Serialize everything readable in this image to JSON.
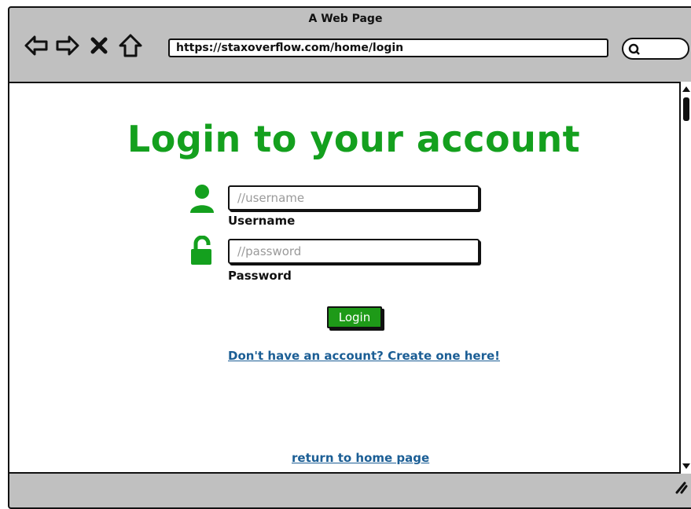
{
  "window": {
    "title": "A Web Page"
  },
  "toolbar": {
    "url": "https://staxoverflow.com/home/login",
    "back_icon": "arrow-left-icon",
    "forward_icon": "arrow-right-icon",
    "stop_icon": "close-x-icon",
    "home_icon": "home-icon",
    "search_icon": "search-icon"
  },
  "login": {
    "title": "Login to your account",
    "username_placeholder": "//username",
    "username_label": "Username",
    "password_placeholder": "//password",
    "password_label": "Password",
    "button_label": "Login",
    "create_account_link": "Don't have an account? Create one here!",
    "return_link": "return to home page"
  },
  "colors": {
    "accent_green": "#14a01e",
    "button_green": "#1e9a18",
    "link_blue": "#1b5e95",
    "chrome_gray": "#c0c0c0"
  }
}
